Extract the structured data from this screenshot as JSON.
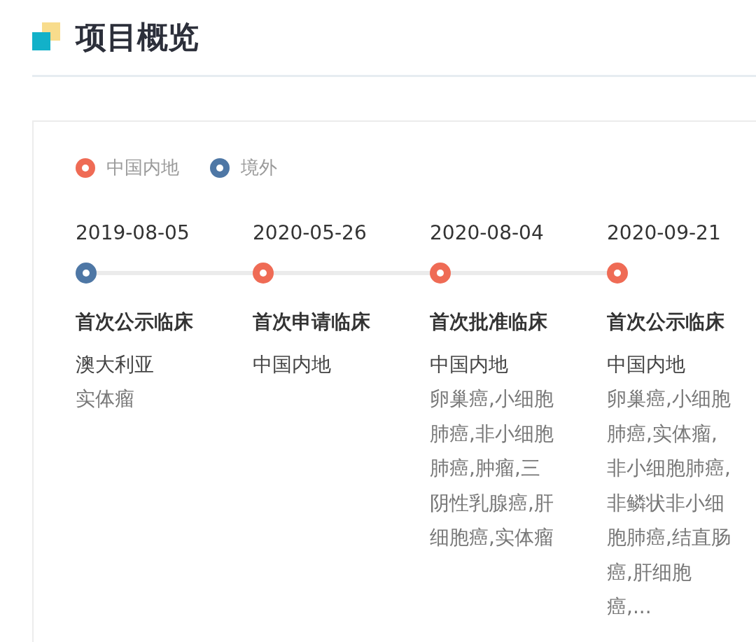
{
  "header": {
    "title": "项目概览"
  },
  "legend": [
    {
      "label": "中国内地",
      "color": "#ef6b55"
    },
    {
      "label": "境外",
      "color": "#4e77a5"
    }
  ],
  "timeline": [
    {
      "date": "2019-08-05",
      "color": "#4e77a5",
      "title": "首次公示临床",
      "region": "澳大利亚",
      "detail": "实体瘤"
    },
    {
      "date": "2020-05-26",
      "color": "#ef6b55",
      "title": "首次申请临床",
      "region": "中国内地"
    },
    {
      "date": "2020-08-04",
      "color": "#ef6b55",
      "title": "首次批准临床",
      "region": "中国内地",
      "detail": "卵巢癌,小细胞肺癌,非小细胞肺癌,肿瘤,三阴性乳腺癌,肝细胞癌,实体瘤"
    },
    {
      "date": "2020-09-21",
      "color": "#ef6b55",
      "title": "首次公示临床",
      "region": "中国内地",
      "detail": "卵巢癌,小细胞肺癌,实体瘤,非小细胞肺癌,非鳞状非小细胞肺癌,结直肠癌,肝细胞癌,..."
    }
  ]
}
